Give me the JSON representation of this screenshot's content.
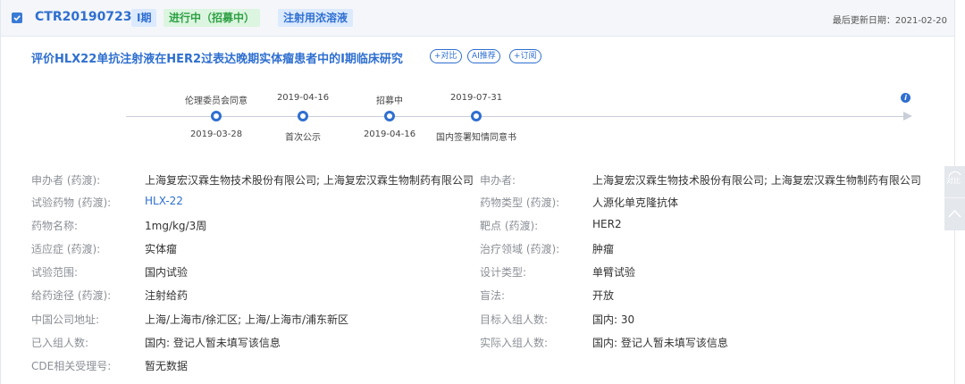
{
  "header": {
    "trial_id": "CTR20190723",
    "phase_tag": "I期",
    "status_tag": "进行中（招募中）",
    "form_tag": "注射用浓溶液",
    "updated": "最后更新日期：2021-02-20"
  },
  "title": "评价HLX22单抗注射液在HER2过表达晚期实体瘤患者中的I期临床研究",
  "actions": {
    "compare": "+对比",
    "ai": "AI推荐",
    "subscribe": "+订阅"
  },
  "timeline": {
    "top": [
      "伦理委员会同意",
      "2019-04-16",
      "招募中",
      "2019-07-31"
    ],
    "bottom": [
      "2019-03-28",
      "首次公示",
      "2019-04-16",
      "国内签署知情同意书"
    ]
  },
  "fields": {
    "left": [
      {
        "label": "申办者 (药渡):",
        "value": "上海复宏汉霖生物技术股份有限公司; 上海复宏汉霖生物制药有限公司"
      },
      {
        "label": "试验药物 (药渡):",
        "value": "HLX-22"
      },
      {
        "label": "药物名称:",
        "value": "1mg/kg/3周"
      },
      {
        "label": "适应症 (药渡):",
        "value": "实体瘤"
      },
      {
        "label": "试验范围:",
        "value": "国内试验"
      },
      {
        "label": "给药途径 (药渡):",
        "value": "注射给药"
      },
      {
        "label": "中国公司地址:",
        "value": "上海/上海市/徐汇区; 上海/上海市/浦东新区"
      },
      {
        "label": "已入组人数:",
        "value": "国内: 登记人暂未填写该信息"
      },
      {
        "label": "CDE相关受理号:",
        "value": "暂无数据"
      }
    ],
    "right": [
      {
        "label": "申办者:",
        "value": "上海复宏汉霖生物技术股份有限公司; 上海复宏汉霖生物制药有限公司"
      },
      {
        "label": "药物类型 (药渡):",
        "value": "人源化单克隆抗体"
      },
      {
        "label": "靶点 (药渡):",
        "value": "HER2"
      },
      {
        "label": "治疗领域 (药渡):",
        "value": "肿瘤"
      },
      {
        "label": "设计类型:",
        "value": "单臂试验"
      },
      {
        "label": "盲法:",
        "value": "开放"
      },
      {
        "label": "目标入组人数:",
        "value": "国内: 30"
      },
      {
        "label": "实际入组人数:",
        "value": "国内: 登记人暂未填写该信息"
      }
    ]
  },
  "side": {
    "compare": "对比"
  },
  "colors": {
    "accent": "#2f6fd0",
    "status_green": "#2ea043"
  },
  "icons": [
    "checkbox-checked-icon",
    "info-icon",
    "chevron-up-icon"
  ]
}
